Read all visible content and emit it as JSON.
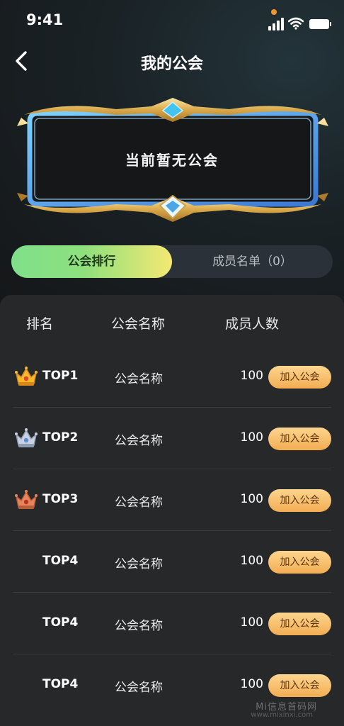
{
  "status_bar": {
    "time": "9:41"
  },
  "header": {
    "title": "我的公会"
  },
  "guild_banner": {
    "text": "当前暂无公会"
  },
  "tabs": [
    {
      "label": "公会排行",
      "active": true
    },
    {
      "label": "成员名单（0）",
      "active": false
    }
  ],
  "table": {
    "columns": [
      "排名",
      "公会名称",
      "成员人数"
    ],
    "rows": [
      {
        "rank": "TOP1",
        "crown": "gold-crown-icon",
        "name": "公会名称",
        "members": "100",
        "action": "加入公会"
      },
      {
        "rank": "TOP2",
        "crown": "silver-crown-icon",
        "name": "公会名称",
        "members": "100",
        "action": "加入公会"
      },
      {
        "rank": "TOP3",
        "crown": "bronze-crown-icon",
        "name": "公会名称",
        "members": "100",
        "action": "加入公会"
      },
      {
        "rank": "TOP4",
        "crown": null,
        "name": "公会名称",
        "members": "100",
        "action": "加入公会"
      },
      {
        "rank": "TOP4",
        "crown": null,
        "name": "公会名称",
        "members": "100",
        "action": "加入公会"
      },
      {
        "rank": "TOP4",
        "crown": null,
        "name": "公会名称",
        "members": "100",
        "action": "加入公会"
      }
    ]
  },
  "watermark": {
    "text": "Mi信息首码网",
    "url": "www.mixinxi.com"
  },
  "colors": {
    "accent_green": "#7fe08a",
    "accent_yellow": "#f5e873",
    "button_orange": "#f3ad53",
    "background": "#1c1e21"
  }
}
